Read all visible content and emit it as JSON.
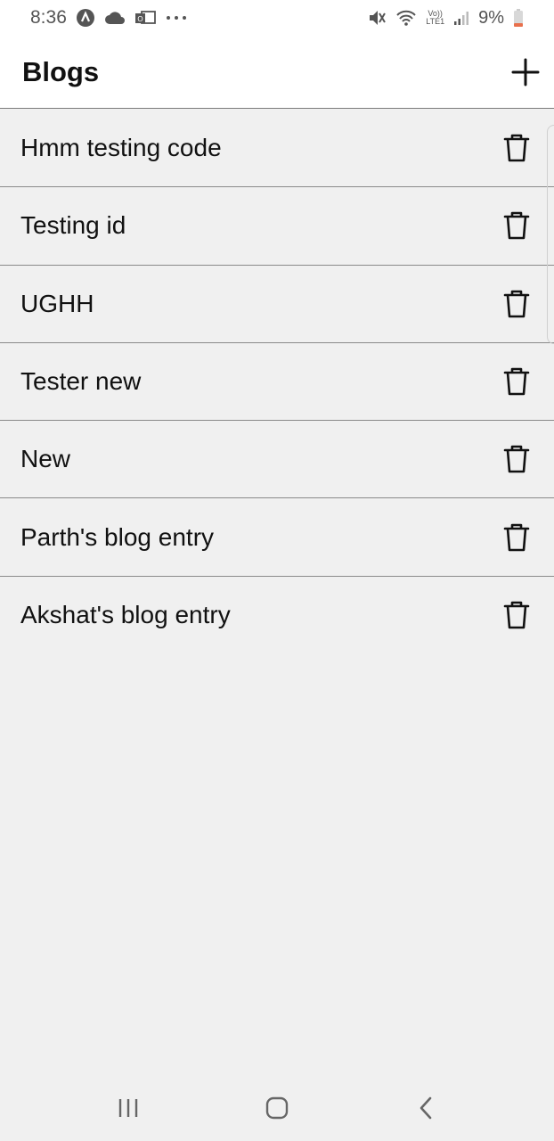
{
  "status_bar": {
    "time": "8:36",
    "battery_percent": "9%",
    "left_icons": [
      "app-notification-icon",
      "cloud-icon",
      "outlook-icon",
      "more-dots-icon"
    ],
    "right_icons": [
      "mute-icon",
      "wifi-icon",
      "volte-lte-icon",
      "signal-icon",
      "battery-low-icon"
    ],
    "volte_label": "Vo))",
    "lte_label": "LTE1",
    "battery_color": "#e8704c"
  },
  "header": {
    "title": "Blogs",
    "add_icon": "plus-icon"
  },
  "blogs": [
    {
      "title": "Hmm testing code"
    },
    {
      "title": "Testing id"
    },
    {
      "title": "UGHH"
    },
    {
      "title": "Tester new"
    },
    {
      "title": "New"
    },
    {
      "title": "Parth's blog entry"
    },
    {
      "title": "Akshat's blog entry"
    }
  ],
  "row_action_icon": "trash-icon",
  "nav_bar": {
    "buttons": [
      "recent-apps-icon",
      "home-icon",
      "back-icon"
    ]
  },
  "colors": {
    "background": "#f0f0f0",
    "header_background": "#ffffff",
    "divider": "#8a8a8a",
    "text": "#111111"
  }
}
